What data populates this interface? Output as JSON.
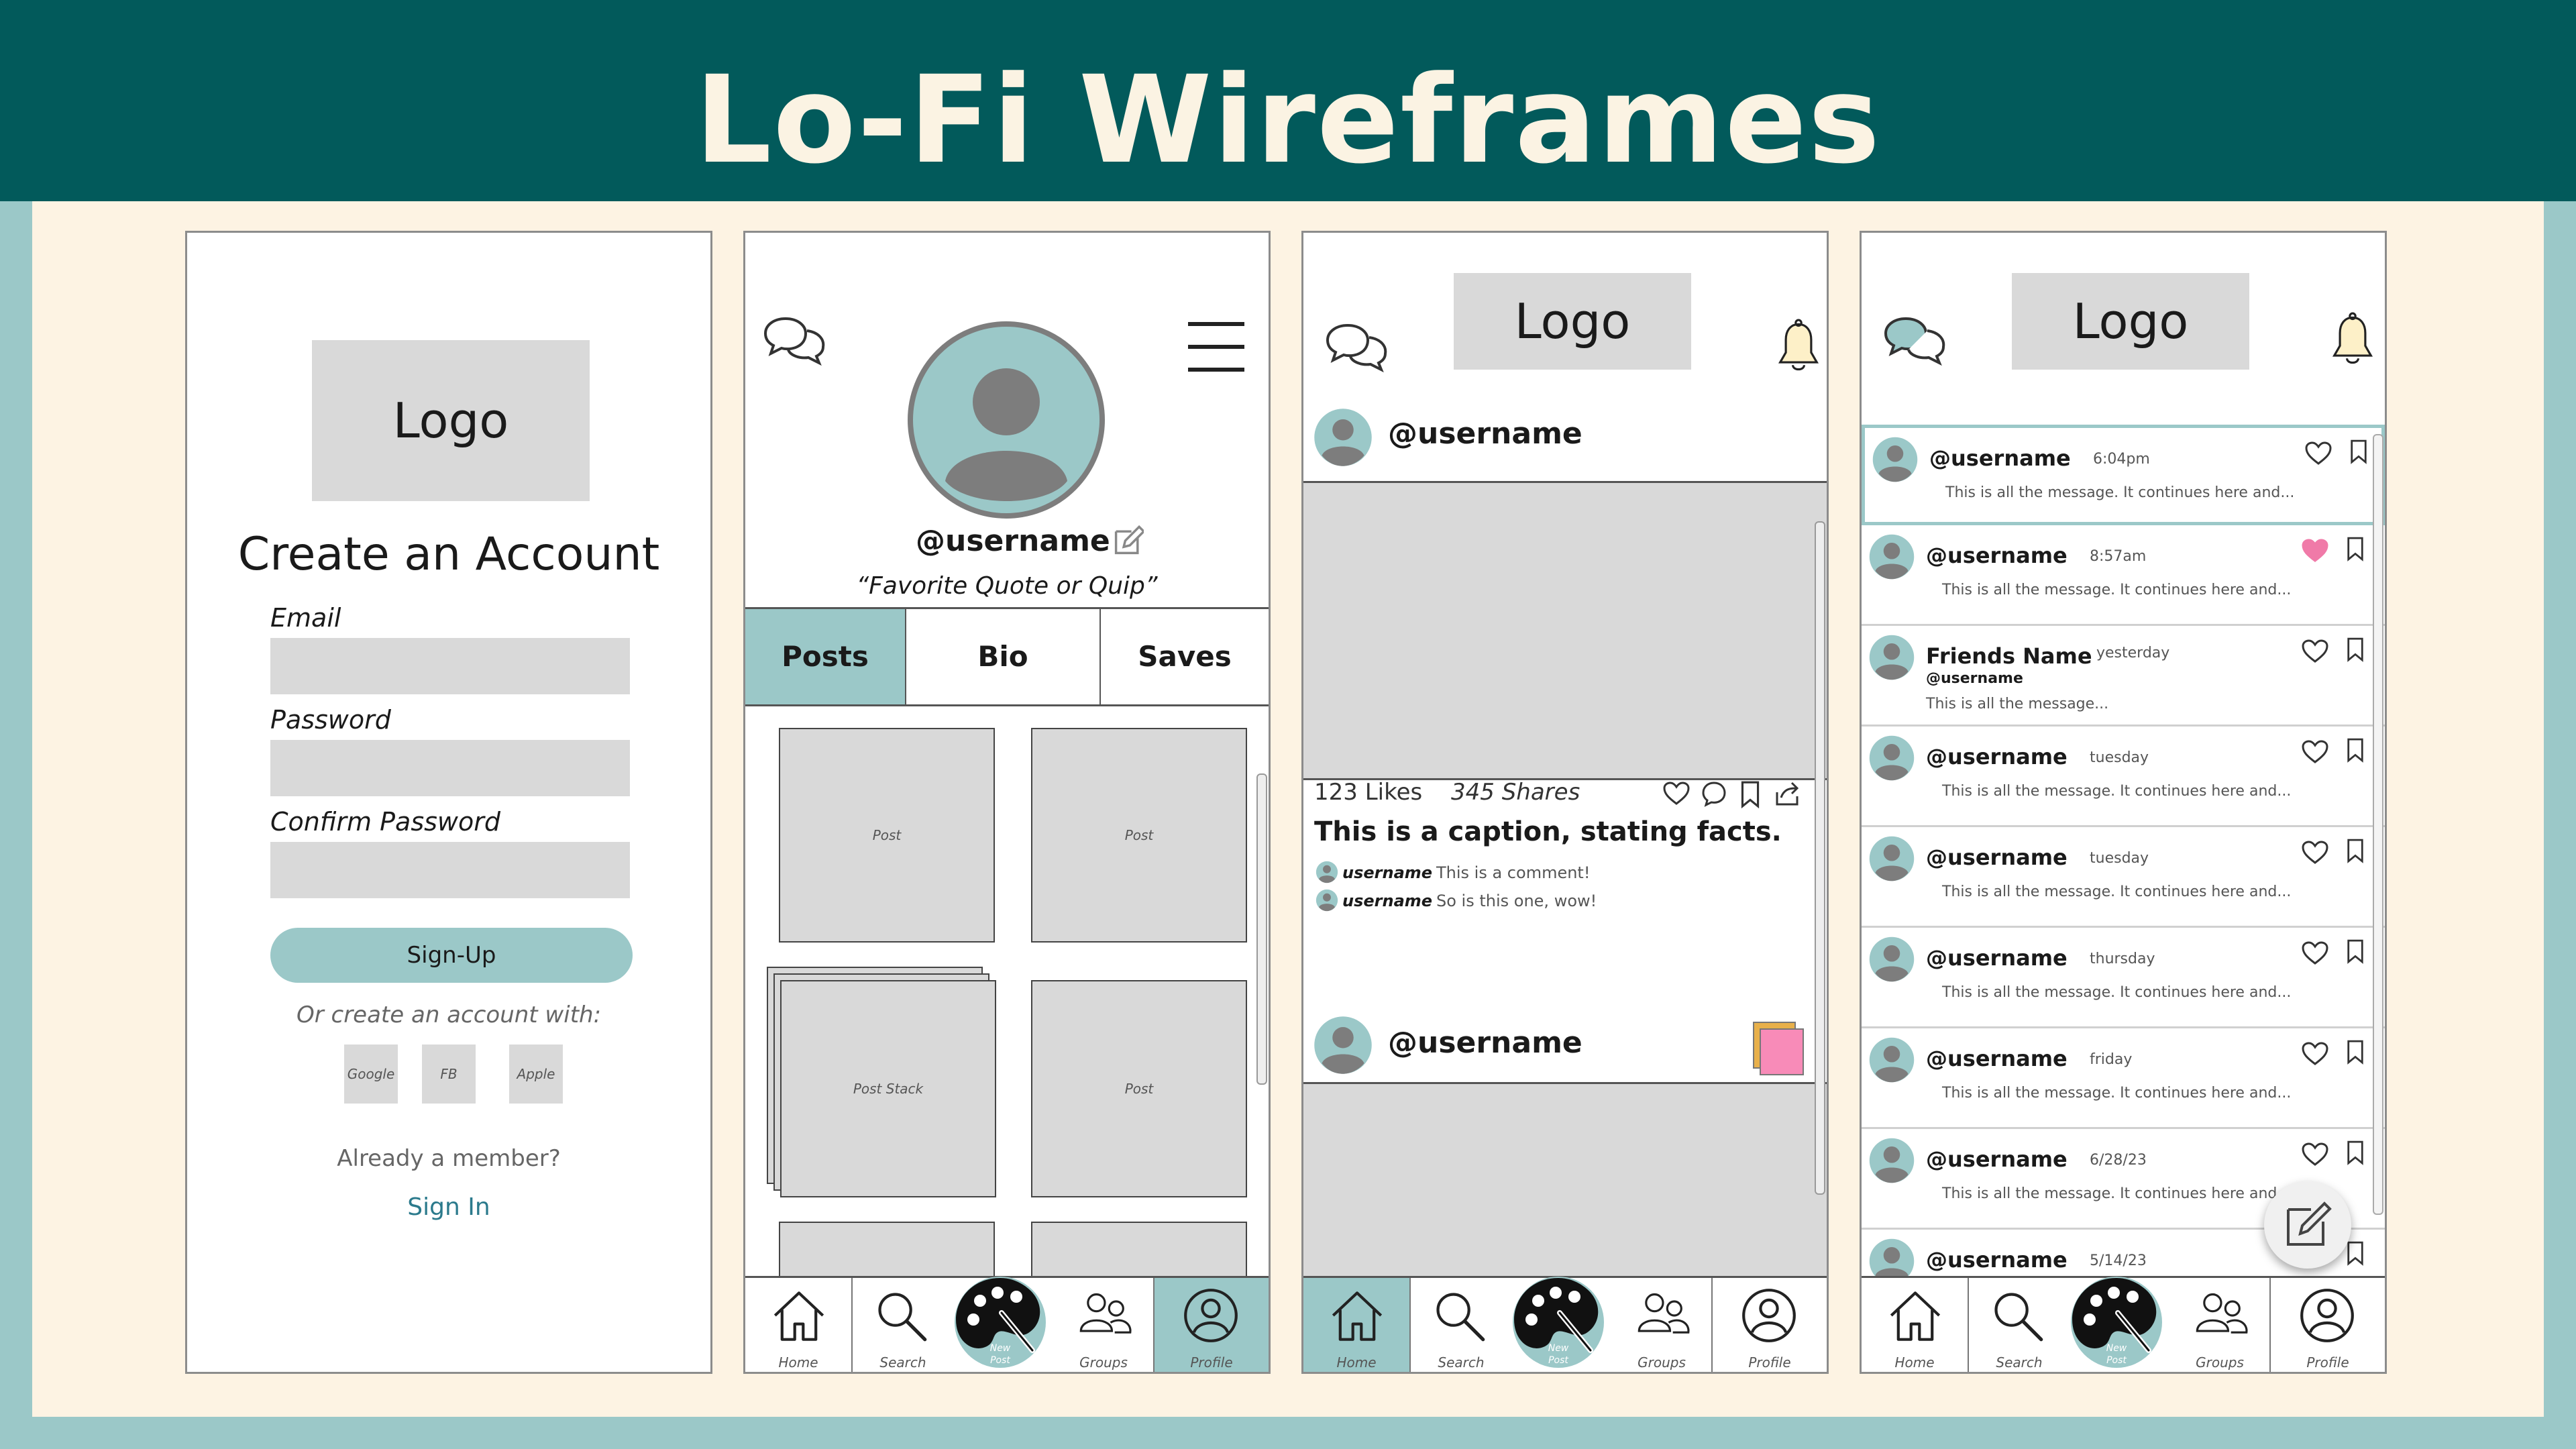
{
  "page": {
    "title": "Lo-Fi Wireframes"
  },
  "signup": {
    "logo": "Logo",
    "heading": "Create an Account",
    "email_label": "Email",
    "password_label": "Password",
    "confirm_label": "Confirm Password",
    "signup_button": "Sign-Up",
    "alt_text": "Or create an account with:",
    "social": [
      "Google",
      "FB",
      "Apple"
    ],
    "member_text": "Already a member?",
    "signin_link": "Sign In"
  },
  "profile": {
    "username": "@username",
    "quote": "“Favorite Quote or Quip”",
    "tabs": [
      "Posts",
      "Bio",
      "Saves"
    ],
    "tiles": [
      "Post",
      "Post",
      "Post Stack",
      "Post"
    ]
  },
  "post_feed": {
    "logo": "Logo",
    "username": "@username",
    "likes": "123 Likes",
    "shares": "345 Shares",
    "caption": "This is a caption, stating facts.",
    "comments": [
      {
        "user": "username",
        "text": "This is a comment!"
      },
      {
        "user": "username",
        "text": "So is this one, wow!"
      }
    ],
    "second_username": "@username"
  },
  "messages": {
    "logo": "Logo",
    "items": [
      {
        "name": "@username",
        "time": "6:04pm",
        "message": "This is all the message. It continues here and..."
      },
      {
        "name": "@username",
        "time": "8:57am",
        "message": "This is all the message. It continues here and..."
      },
      {
        "name": "Friends Name",
        "handle": "@username",
        "time": "yesterday",
        "message": "This is all the message..."
      },
      {
        "name": "@username",
        "time": "tuesday",
        "message": "This is all the message. It continues here and..."
      },
      {
        "name": "@username",
        "time": "tuesday",
        "message": "This is all the message. It continues here and..."
      },
      {
        "name": "@username",
        "time": "thursday",
        "message": "This is all the message. It continues here and..."
      },
      {
        "name": "@username",
        "time": "friday",
        "message": "This is all the message. It continues here and..."
      },
      {
        "name": "@username",
        "time": "6/28/23",
        "message": "This is all the message. It continues here and..."
      },
      {
        "name": "@username",
        "time": "5/14/23",
        "message": ""
      }
    ]
  },
  "nav": {
    "home": "Home",
    "search": "Search",
    "new_post_line1": "New",
    "new_post_line2": "Post",
    "groups": "Groups",
    "profile": "Profile"
  },
  "colors": {
    "teal_dark": "#025a5b",
    "teal_light": "#9bc8c8",
    "cream": "#fdf3e3",
    "placeholder": "#d9d9d9",
    "heart_pink": "#f07aa8",
    "sticky_pink": "#f88bb8"
  }
}
